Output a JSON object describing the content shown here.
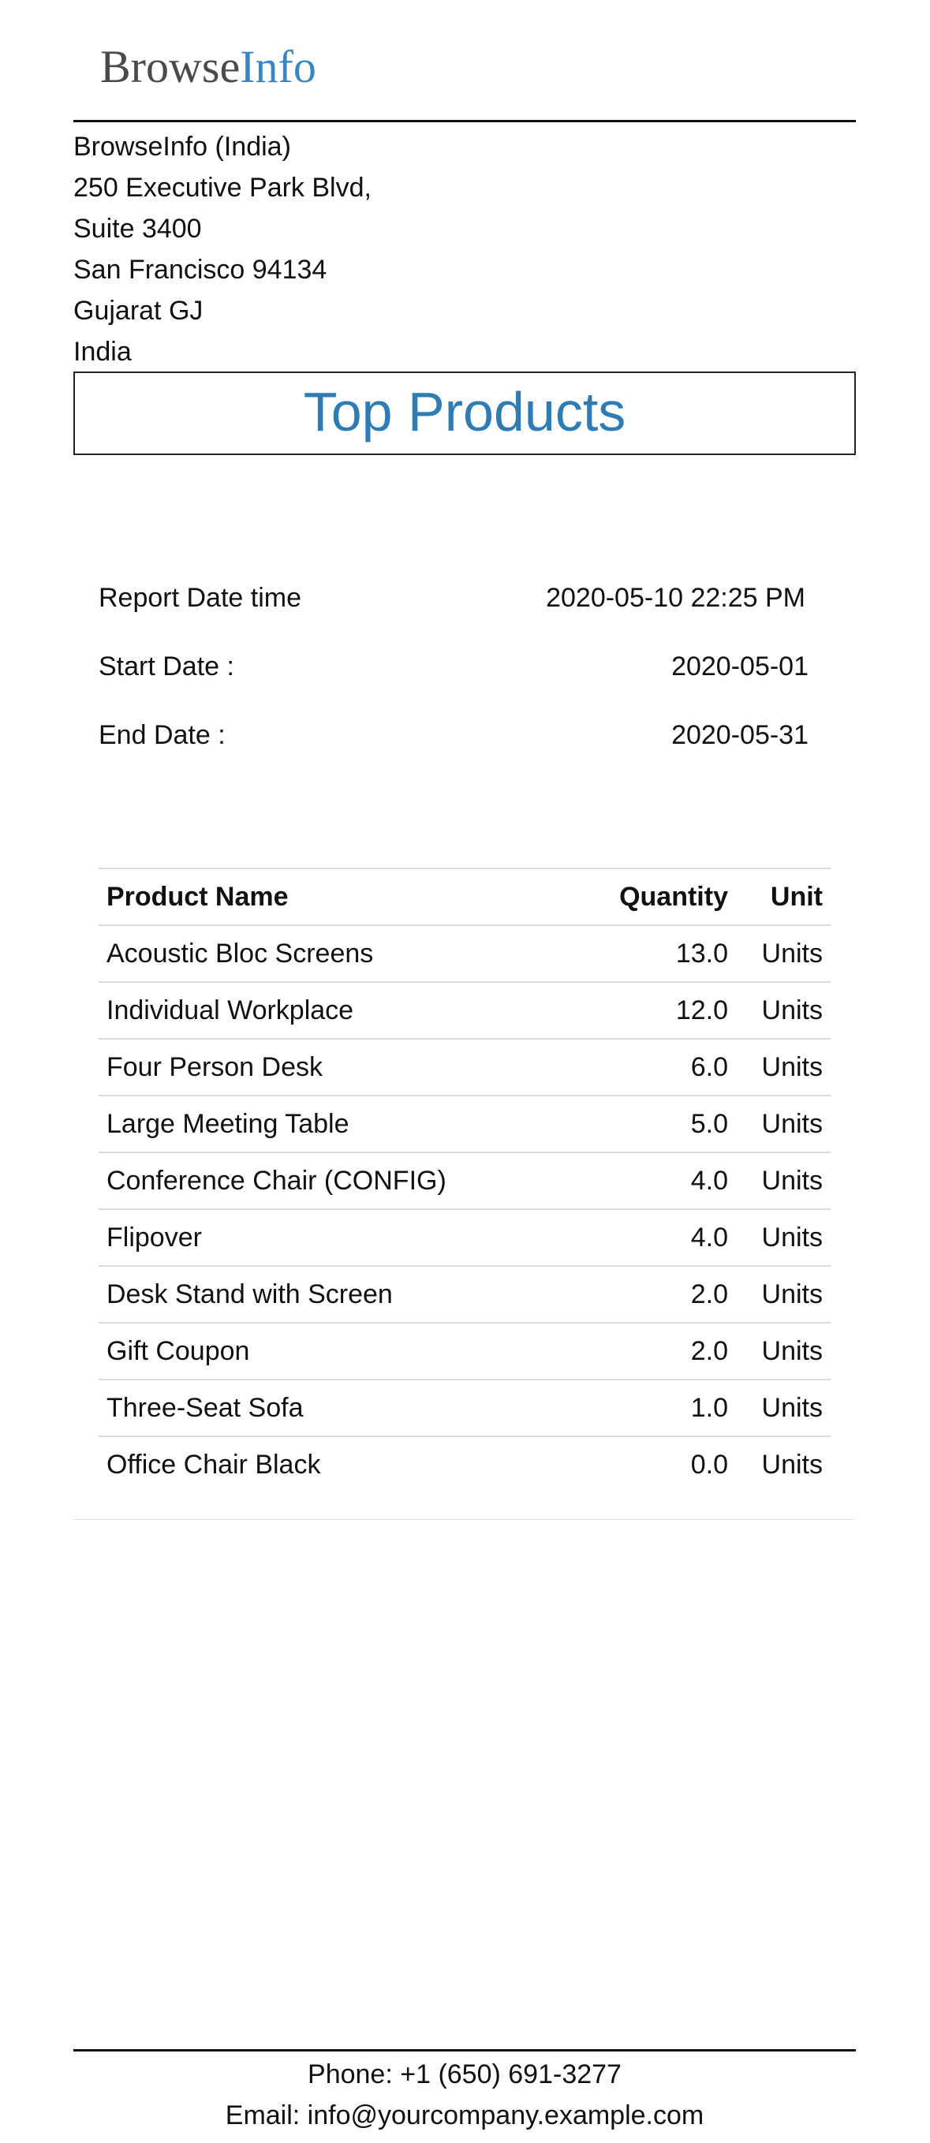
{
  "header": {
    "logo_part1": "Browse",
    "logo_part2": "Info"
  },
  "company": {
    "name": "BrowseInfo (India)",
    "street": "250 Executive Park Blvd,",
    "suite": "Suite 3400",
    "city": "San Francisco 94134",
    "state": "Gujarat GJ",
    "country": "India"
  },
  "report": {
    "title": "Top Products",
    "meta": [
      {
        "label": "Report Date time",
        "value": "2020-05-10 22:25 PM"
      },
      {
        "label": "Start Date :",
        "value": "2020-05-01"
      },
      {
        "label": "End Date :",
        "value": "2020-05-31"
      }
    ]
  },
  "table": {
    "headers": {
      "product": "Product Name",
      "quantity": "Quantity",
      "unit": "Unit"
    },
    "rows": [
      {
        "product": "Acoustic Bloc Screens",
        "quantity": "13.0",
        "unit": "Units"
      },
      {
        "product": "Individual Workplace",
        "quantity": "12.0",
        "unit": "Units"
      },
      {
        "product": "Four Person Desk",
        "quantity": "6.0",
        "unit": "Units"
      },
      {
        "product": "Large Meeting Table",
        "quantity": "5.0",
        "unit": "Units"
      },
      {
        "product": "Conference Chair (CONFIG)",
        "quantity": "4.0",
        "unit": "Units"
      },
      {
        "product": "Flipover",
        "quantity": "4.0",
        "unit": "Units"
      },
      {
        "product": "Desk Stand with Screen",
        "quantity": "2.0",
        "unit": "Units"
      },
      {
        "product": "Gift Coupon",
        "quantity": "2.0",
        "unit": "Units"
      },
      {
        "product": "Three-Seat Sofa",
        "quantity": "1.0",
        "unit": "Units"
      },
      {
        "product": "Office Chair Black",
        "quantity": "0.0",
        "unit": "Units"
      }
    ]
  },
  "footer": {
    "phone": "Phone: +1 (650) 691-3277",
    "email": "Email: info@yourcompany.example.com"
  },
  "colors": {
    "title": "#2e7cb6",
    "logo_accent": "#3a84c4",
    "logo_base": "#4a4a4a"
  }
}
